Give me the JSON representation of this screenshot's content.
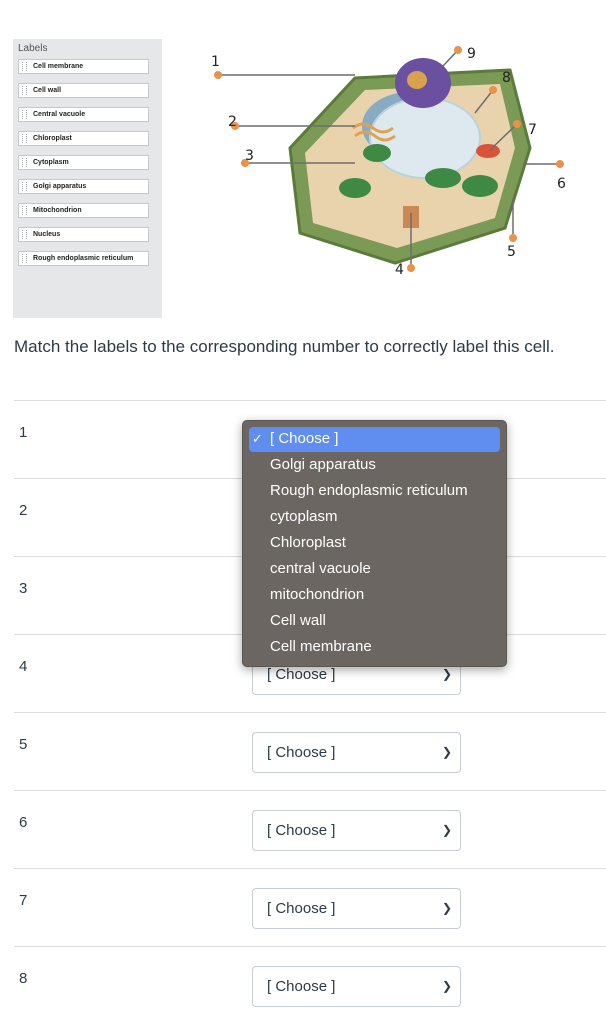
{
  "labels_panel": {
    "title": "Labels",
    "items": [
      "Cell membrane",
      "Cell wall",
      "Central vacuole",
      "Chloroplast",
      "Cytoplasm",
      "Golgi apparatus",
      "Mitochondrion",
      "Nucleus",
      "Rough endoplasmic reticulum"
    ]
  },
  "diagram": {
    "numbers": [
      "1",
      "2",
      "3",
      "4",
      "5",
      "6",
      "7",
      "8",
      "9"
    ],
    "marker_color": "#e8924a"
  },
  "instruction": "Match the labels to the corresponding number to correctly label this cell.",
  "rows": [
    {
      "number": "1",
      "value": "[ Choose ]"
    },
    {
      "number": "2",
      "value": "[ Choose ]"
    },
    {
      "number": "3",
      "value": "[ Choose ]"
    },
    {
      "number": "4",
      "value": "[ Choose ]"
    },
    {
      "number": "5",
      "value": "[ Choose ]"
    },
    {
      "number": "6",
      "value": "[ Choose ]"
    },
    {
      "number": "7",
      "value": "[ Choose ]"
    },
    {
      "number": "8",
      "value": "[ Choose ]"
    }
  ],
  "dropdown": {
    "check": "✓",
    "options": [
      "[ Choose ]",
      "Golgi apparatus",
      "Rough endoplasmic reticulum",
      "cytoplasm",
      "Chloroplast",
      "central vacuole",
      "mitochondrion",
      "Cell wall",
      "Cell membrane"
    ],
    "selected_index": 0,
    "highlight_color": "#5f8ef0"
  }
}
